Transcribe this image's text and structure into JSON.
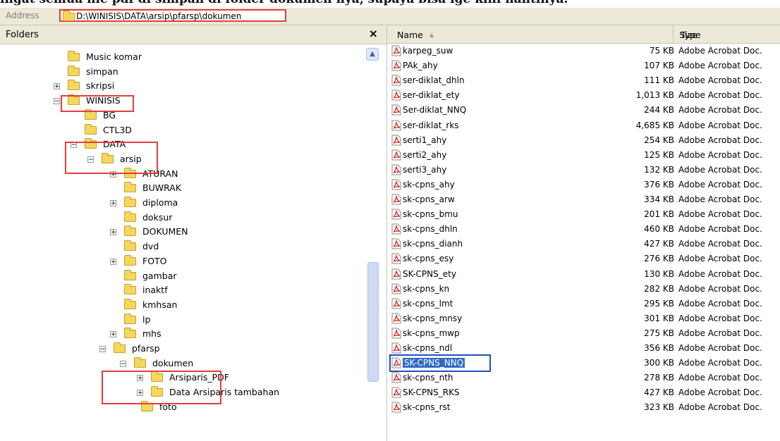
{
  "caption": "ingat semua file pdf di simpan di folder dokumen nya, supaya bisa lge kini nantinya.",
  "address": {
    "label": "Address",
    "path": "D:\\WINISIS\\DATA\\arsip\\pfarsp\\dokumen"
  },
  "folders": {
    "title": "Folders",
    "close_label": "×",
    "tree": [
      {
        "label": "Music komar"
      },
      {
        "label": "simpan"
      },
      {
        "label": "skripsi",
        "expander": "+"
      },
      {
        "label": "WINISIS",
        "expander": "−"
      },
      {
        "label": "BG"
      },
      {
        "label": "CTL3D"
      },
      {
        "label": "DATA",
        "expander": "−"
      },
      {
        "label": "arsip",
        "expander": "−"
      },
      {
        "label": "ATURAN",
        "expander": "+"
      },
      {
        "label": "BUWRAK"
      },
      {
        "label": "diploma",
        "expander": "+"
      },
      {
        "label": "doksur"
      },
      {
        "label": "DOKUMEN",
        "expander": "+"
      },
      {
        "label": "dvd"
      },
      {
        "label": "FOTO",
        "expander": "+"
      },
      {
        "label": "gambar"
      },
      {
        "label": "inaktf"
      },
      {
        "label": "kmhsan"
      },
      {
        "label": "lp"
      },
      {
        "label": "mhs",
        "expander": "+"
      },
      {
        "label": "pfarsp",
        "expander": "−"
      },
      {
        "label": "dokumen",
        "expander": "−"
      },
      {
        "label": "Arsiparis_PDF",
        "expander": "+"
      },
      {
        "label": "Data Arsiparis tambahan",
        "expander": "+"
      },
      {
        "label": "foto"
      }
    ]
  },
  "files": {
    "columns": {
      "name": "Name",
      "sort_indicator": "▲",
      "size": "Size",
      "type": "Type"
    },
    "rows": [
      {
        "name": "karpeg_suw",
        "size": "75 KB",
        "type": "Adobe Acrobat Doc."
      },
      {
        "name": "PAk_ahy",
        "size": "107 KB",
        "type": "Adobe Acrobat Doc."
      },
      {
        "name": "ser-diklat_dhln",
        "size": "111 KB",
        "type": "Adobe Acrobat Doc."
      },
      {
        "name": "ser-diklat_ety",
        "size": "1,013 KB",
        "type": "Adobe Acrobat Doc."
      },
      {
        "name": "Ser-diklat_NNQ",
        "size": "244 KB",
        "type": "Adobe Acrobat Doc."
      },
      {
        "name": "ser-diklat_rks",
        "size": "4,685 KB",
        "type": "Adobe Acrobat Doc."
      },
      {
        "name": "serti1_ahy",
        "size": "254 KB",
        "type": "Adobe Acrobat Doc."
      },
      {
        "name": "serti2_ahy",
        "size": "125 KB",
        "type": "Adobe Acrobat Doc."
      },
      {
        "name": "serti3_ahy",
        "size": "132 KB",
        "type": "Adobe Acrobat Doc."
      },
      {
        "name": "sk-cpns_ahy",
        "size": "376 KB",
        "type": "Adobe Acrobat Doc."
      },
      {
        "name": "sk-cpns_arw",
        "size": "334 KB",
        "type": "Adobe Acrobat Doc."
      },
      {
        "name": "sk-cpns_bmu",
        "size": "201 KB",
        "type": "Adobe Acrobat Doc."
      },
      {
        "name": "sk-cpns_dhln",
        "size": "460 KB",
        "type": "Adobe Acrobat Doc."
      },
      {
        "name": "sk-cpns_dianh",
        "size": "427 KB",
        "type": "Adobe Acrobat Doc."
      },
      {
        "name": "sk-cpns_esy",
        "size": "276 KB",
        "type": "Adobe Acrobat Doc."
      },
      {
        "name": "SK-CPNS_ety",
        "size": "130 KB",
        "type": "Adobe Acrobat Doc."
      },
      {
        "name": "sk-cpns_kn",
        "size": "282 KB",
        "type": "Adobe Acrobat Doc."
      },
      {
        "name": "sk-cpns_lmt",
        "size": "295 KB",
        "type": "Adobe Acrobat Doc."
      },
      {
        "name": "sk-cpns_mnsy",
        "size": "301 KB",
        "type": "Adobe Acrobat Doc."
      },
      {
        "name": "sk-cpns_mwp",
        "size": "275 KB",
        "type": "Adobe Acrobat Doc."
      },
      {
        "name": "sk-cpns_ndl",
        "size": "356 KB",
        "type": "Adobe Acrobat Doc."
      },
      {
        "name": "SK-CPNS_NNQ",
        "size": "300 KB",
        "type": "Adobe Acrobat Doc.",
        "selected": true
      },
      {
        "name": "sk-cpns_nth",
        "size": "278 KB",
        "type": "Adobe Acrobat Doc."
      },
      {
        "name": "SK-CPNS_RKS",
        "size": "427 KB",
        "type": "Adobe Acrobat Doc."
      },
      {
        "name": "sk-cpns_rst",
        "size": "323 KB",
        "type": "Adobe Acrobat Doc."
      }
    ]
  },
  "icons": {
    "folder": "folder-icon",
    "pdf": "pdf-file-icon"
  },
  "colors": {
    "highlight_box": "#e63c3c",
    "selection": "#316ac5",
    "folder_yellow": "#f5d65e"
  }
}
